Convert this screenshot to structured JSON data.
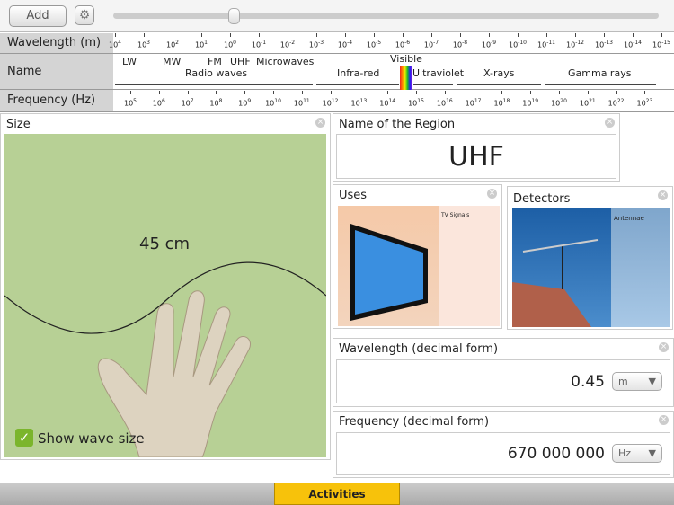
{
  "toolbar": {
    "add_label": "Add",
    "settings_icon": "gear-icon",
    "slider_value": 0.22
  },
  "scale": {
    "wavelength_label": "Wavelength (m)",
    "name_label": "Name",
    "frequency_label": "Frequency (Hz)",
    "wavelength_exponents": [
      "4",
      "3",
      "2",
      "1",
      "0",
      "-1",
      "-2",
      "-3",
      "-4",
      "-5",
      "-6",
      "-7",
      "-8",
      "-9",
      "-10",
      "-11",
      "-12",
      "-13",
      "-14",
      "-15"
    ],
    "frequency_exponents": [
      "5",
      "6",
      "7",
      "8",
      "9",
      "10",
      "11",
      "12",
      "13",
      "14",
      "15",
      "16",
      "17",
      "18",
      "19",
      "20",
      "21",
      "22",
      "23"
    ],
    "sub_names": [
      "LW",
      "MW",
      "FM",
      "UHF",
      "Microwaves"
    ],
    "regions": [
      "Radio waves",
      "Infra-red",
      "Visible",
      "Ultraviolet",
      "X-rays",
      "Gamma rays"
    ]
  },
  "size_panel": {
    "title": "Size",
    "wave_size": "45 cm",
    "show_wave_label": "Show wave size",
    "show_wave_checked": true
  },
  "name_panel": {
    "title": "Name of the Region",
    "value": "UHF"
  },
  "uses_panel": {
    "title": "Uses",
    "caption": "TV Signals"
  },
  "detectors_panel": {
    "title": "Detectors",
    "caption": "Antennae"
  },
  "wavelength_panel": {
    "title": "Wavelength (decimal form)",
    "value": "0.45",
    "unit": "m"
  },
  "frequency_panel": {
    "title": "Frequency (decimal form)",
    "value": "670 000 000",
    "unit": "Hz"
  },
  "bottom": {
    "activities_label": "Activities"
  }
}
